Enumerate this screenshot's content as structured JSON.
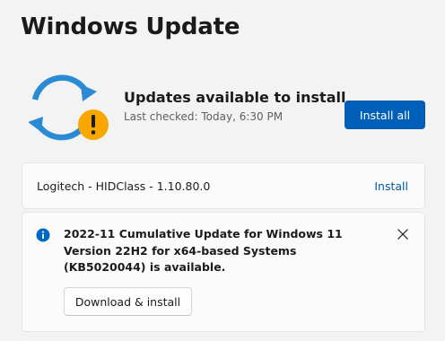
{
  "page": {
    "title": "Windows Update"
  },
  "status": {
    "title": "Updates available to install",
    "last_checked": "Last checked: Today, 6:30 PM",
    "install_all_label": "Install all",
    "icon": "sync-warning-icon"
  },
  "updates": [
    {
      "name": "Logitech - HIDClass - 1.10.80.0",
      "action_label": "Install"
    },
    {
      "description": "2022-11 Cumulative Update for Windows 11 Version 22H2 for x64-based Systems (KB5020044) is available.",
      "action_label": "Download & install",
      "icon": "info-icon"
    }
  ],
  "colors": {
    "accent": "#005fb8",
    "link": "#005a9e",
    "warning": "#f7a700",
    "sync_blue": "#2a8ad4",
    "info_blue": "#0067c0",
    "background": "#f3f3f3",
    "card": "#fbfbfb"
  }
}
